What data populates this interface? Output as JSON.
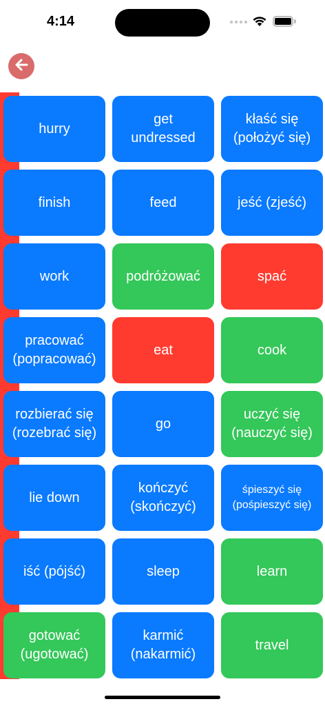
{
  "status": {
    "time": "4:14"
  },
  "icons": {
    "back": "arrow-left-icon",
    "wifi": "wifi-icon",
    "battery": "battery-icon",
    "signal": "cellular-signal-icon"
  },
  "colors": {
    "blue": "#0a7aff",
    "green": "#34c759",
    "red": "#ff3b30",
    "back_button": "#d96b6b",
    "left_bar": "#ff3b30"
  },
  "tiles": [
    {
      "label": "hurry",
      "color": "blue"
    },
    {
      "label": "get\nundressed",
      "color": "blue"
    },
    {
      "label": "kłaść się\n(położyć się)",
      "color": "blue"
    },
    {
      "label": "finish",
      "color": "blue"
    },
    {
      "label": "feed",
      "color": "blue"
    },
    {
      "label": "jeść (zjeść)",
      "color": "blue"
    },
    {
      "label": "work",
      "color": "blue"
    },
    {
      "label": "podróżować",
      "color": "green"
    },
    {
      "label": "spać",
      "color": "red"
    },
    {
      "label": "pracować\n(popracować)",
      "color": "blue"
    },
    {
      "label": "eat",
      "color": "red"
    },
    {
      "label": "cook",
      "color": "green"
    },
    {
      "label": "rozbierać się\n(rozebrać się)",
      "color": "blue"
    },
    {
      "label": "go",
      "color": "blue"
    },
    {
      "label": "uczyć się\n(nauczyć się)",
      "color": "green"
    },
    {
      "label": "lie down",
      "color": "blue"
    },
    {
      "label": "kończyć\n(skończyć)",
      "color": "blue"
    },
    {
      "label": "śpieszyć się\n(pośpieszyć się)",
      "color": "blue",
      "small": true
    },
    {
      "label": "iść (pójść)",
      "color": "blue"
    },
    {
      "label": "sleep",
      "color": "blue"
    },
    {
      "label": "learn",
      "color": "green"
    },
    {
      "label": "gotować\n(ugotować)",
      "color": "green"
    },
    {
      "label": "karmić\n(nakarmić)",
      "color": "blue"
    },
    {
      "label": "travel",
      "color": "green"
    }
  ]
}
